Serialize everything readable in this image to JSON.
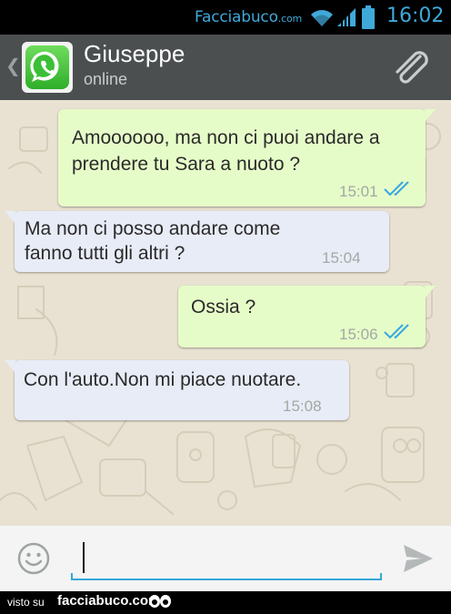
{
  "status_bar": {
    "brand_main": "Facciabuco",
    "brand_suffix": ".com",
    "time": "16:02",
    "icons": [
      "wifi-icon",
      "signal-icon",
      "battery-icon"
    ]
  },
  "header": {
    "back_glyph": "❮",
    "contact_name": "Giuseppe",
    "contact_status": "online",
    "icons": [
      "whatsapp-logo-icon",
      "paperclip-icon"
    ]
  },
  "messages": [
    {
      "direction": "outgoing",
      "lines": [
        "Amoooooo, ma non ci puoi andare a",
        "prendere tu Sara a nuoto ?"
      ],
      "time": "15:01",
      "read": true
    },
    {
      "direction": "incoming",
      "lines": [
        "Ma non ci posso andare come",
        "fanno tutti gli altri ?"
      ],
      "time": "15:04"
    },
    {
      "direction": "outgoing",
      "lines": [
        "Ossia ?"
      ],
      "time": "15:06",
      "read": true
    },
    {
      "direction": "incoming",
      "lines": [
        "Con l'auto.Non mi piace nuotare."
      ],
      "time": "15:08"
    }
  ],
  "input_bar": {
    "value": "",
    "icons": [
      "emoji-icon",
      "send-icon"
    ]
  },
  "footer": {
    "visto": "visto su",
    "brand": "facciabuco.com"
  },
  "colors": {
    "status_accent": "#3fa9d9",
    "header_bg": "#4b4f4f",
    "chat_bg": "#e9e2d3",
    "outgoing_bubble": "#e6fcc8",
    "incoming_bubble": "#e8ecf7",
    "read_tick": "#34a8e0",
    "input_underline": "#37a6d6"
  }
}
